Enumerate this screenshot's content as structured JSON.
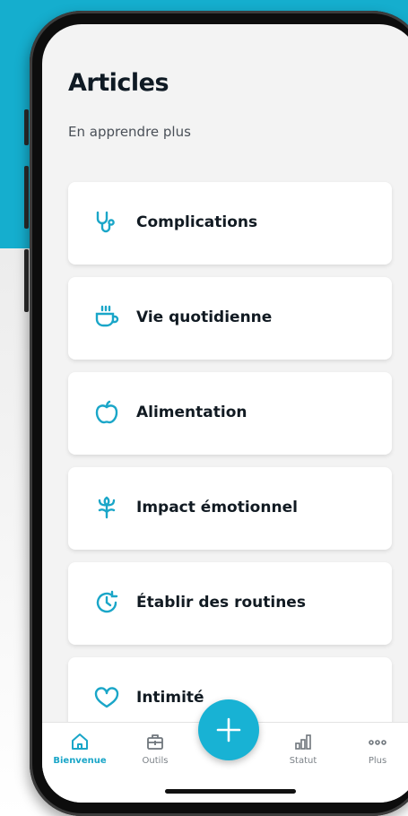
{
  "page": {
    "title": "Articles",
    "subtitle": "En apprendre plus"
  },
  "articles": [
    {
      "label": "Complications",
      "icon": "stethoscope-icon"
    },
    {
      "label": "Vie quotidienne",
      "icon": "coffee-cup-icon"
    },
    {
      "label": "Alimentation",
      "icon": "apple-icon"
    },
    {
      "label": "Impact émotionnel",
      "icon": "flower-icon"
    },
    {
      "label": "Établir des routines",
      "icon": "clock-refresh-icon"
    },
    {
      "label": "Intimité",
      "icon": "heart-icon"
    }
  ],
  "tabs": [
    {
      "label": "Bienvenue",
      "icon": "home-icon",
      "active": true
    },
    {
      "label": "Outils",
      "icon": "toolbox-icon",
      "active": false
    },
    {
      "label": "Statut",
      "icon": "bar-chart-icon",
      "active": false
    },
    {
      "label": "Plus",
      "icon": "more-dots-icon",
      "active": false
    }
  ],
  "fab": {
    "icon": "plus-icon"
  },
  "colors": {
    "accent": "#18b2d4",
    "background_top": "#15aece",
    "card": "#ffffff",
    "text": "#111a22"
  }
}
